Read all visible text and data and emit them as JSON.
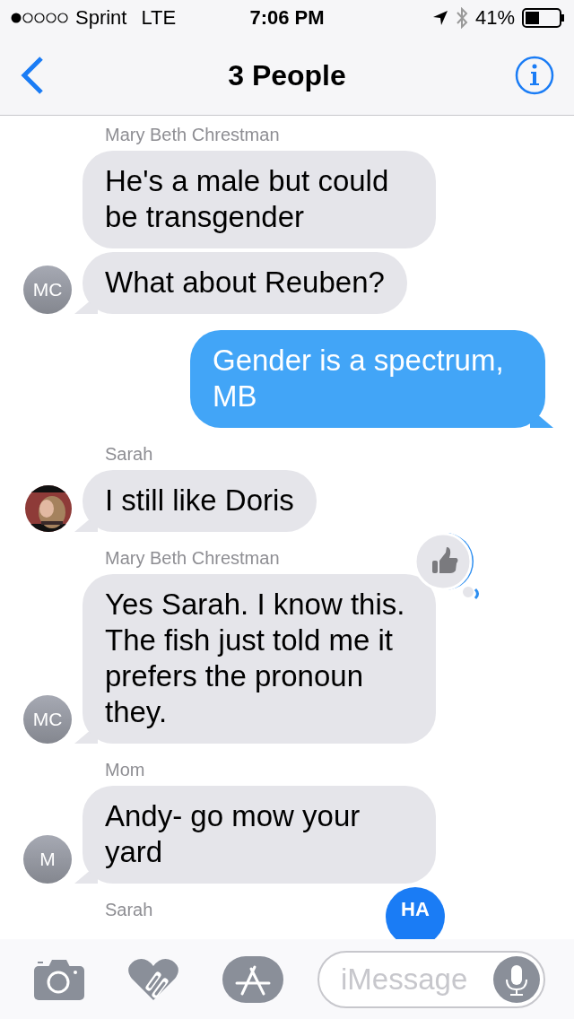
{
  "status_bar": {
    "carrier": "Sprint",
    "network": "LTE",
    "time": "7:06 PM",
    "battery": "41%"
  },
  "nav": {
    "title": "3 People"
  },
  "groups": [
    {
      "kind": "incoming",
      "sender": "Mary Beth Chrestman",
      "avatar": {
        "kind": "initials",
        "text": "MC"
      },
      "bubbles": [
        {
          "text": "He's a male but could be transgender"
        },
        {
          "text": "What about Reuben?"
        }
      ]
    },
    {
      "kind": "outgoing",
      "bubbles": [
        {
          "text": "Gender is a spectrum, MB"
        }
      ]
    },
    {
      "kind": "incoming",
      "sender": "Sarah",
      "avatar": {
        "kind": "picture"
      },
      "bubbles": [
        {
          "text": "I still like Doris"
        }
      ]
    },
    {
      "kind": "incoming",
      "sender": "Mary Beth Chrestman",
      "avatar": {
        "kind": "initials",
        "text": "MC"
      },
      "bubbles": [
        {
          "text": "Yes Sarah. I know this. The fish just told me it prefers the pronoun they.",
          "reaction": {
            "kind": "thumbs"
          }
        }
      ]
    },
    {
      "kind": "incoming",
      "sender": "Mom",
      "avatar": {
        "kind": "initials",
        "text": "M"
      },
      "bubbles": [
        {
          "text": "Andy- go mow your yard"
        }
      ]
    },
    {
      "kind": "incoming",
      "sender": "Sarah",
      "reaction": {
        "kind": "text",
        "text": "HA"
      }
    }
  ],
  "composer": {
    "placeholder": "iMessage"
  }
}
